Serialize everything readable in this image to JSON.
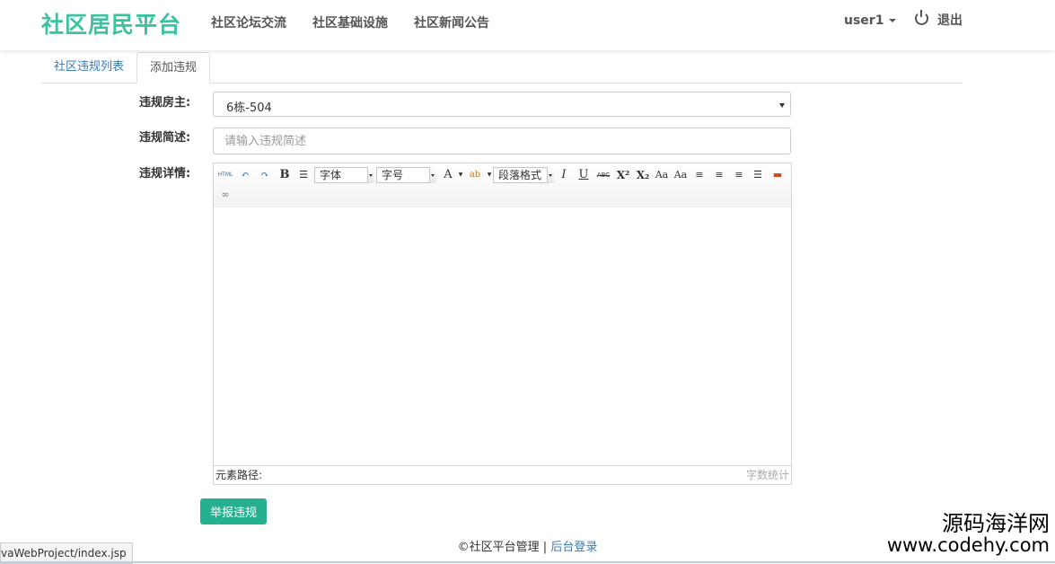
{
  "navbar": {
    "brand": "社区居民平台",
    "links": [
      "社区论坛交流",
      "社区基础设施",
      "社区新闻公告"
    ],
    "user": "user1",
    "logout": "退出"
  },
  "tabs": {
    "list": "社区违规列表",
    "add": "添加违规"
  },
  "form": {
    "owner_label": "违规房主:",
    "owner_value": "6栋-504",
    "summary_label": "违规简述:",
    "summary_placeholder": "请输入违规简述",
    "detail_label": "违规详情:"
  },
  "editor": {
    "toolbar": {
      "html": "HTML",
      "bold": "B",
      "font_family": "字体",
      "font_size": "字号",
      "font_color": "A",
      "paragraph_format": "段落格式",
      "italic": "I",
      "underline": "U",
      "strike": "ABC"
    },
    "path_label": "元素路径:",
    "word_count": "字数统计"
  },
  "submit_label": "举报违规",
  "footer": {
    "copyright": "©社区平台管理 |",
    "admin_link": "后台登录"
  },
  "status_url": "vaWebProject/index.jsp",
  "watermark": {
    "line1": "源码海洋网",
    "line2": "www.codehy.com"
  },
  "colors": {
    "brand": "#3cc2a0",
    "button": "#25b08f",
    "link": "#3a7ab0"
  }
}
